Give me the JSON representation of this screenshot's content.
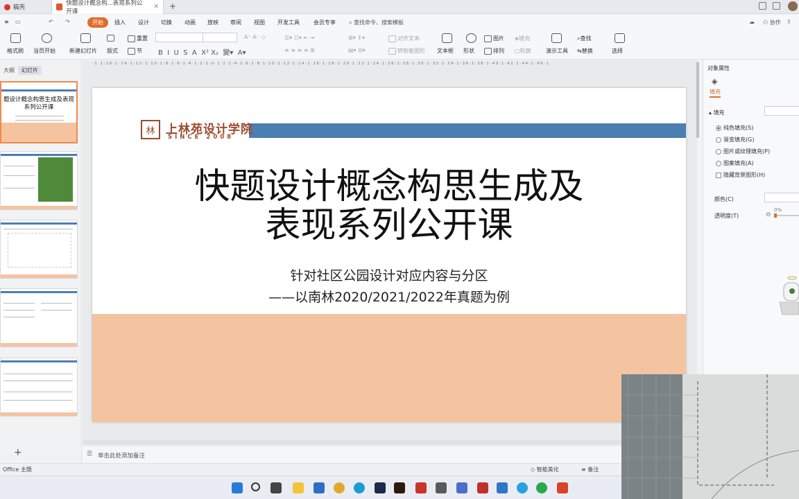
{
  "tabs": [
    {
      "label": "稿壳"
    },
    {
      "label": "快题设计概念构...表现系列公开课"
    }
  ],
  "menu": {
    "items": [
      "开始",
      "插入",
      "设计",
      "切换",
      "动画",
      "放映",
      "审阅",
      "视图",
      "开发工具",
      "会员专享"
    ],
    "active": "开始",
    "search": "查找命令、搜索模板",
    "collab": "协作",
    "share": "分享"
  },
  "ribbon": {
    "paste_label": "粘贴",
    "format_painter": "格式刷",
    "from_current": "当页开始",
    "new_slide": "新建幻灯片",
    "layout": "版式",
    "section": "节",
    "reset": "重置",
    "textbox": "文本框",
    "shape": "形状",
    "picture": "图片",
    "fill": "填充",
    "arrange": "排列",
    "outline": "轮廓",
    "presenter": "演示工具",
    "find": "查找",
    "replace": "替换",
    "select": "选择",
    "align_text": "对齐文本",
    "convert_smartart": "转智能图形"
  },
  "left_panel": {
    "tab_outline": "大纲",
    "tab_slides": "幻灯片",
    "thumb1_title": "题设计概念构思生成及表现系列公开课",
    "add": "+"
  },
  "slide": {
    "logo_glyph": "林",
    "logo_name": "上林苑设计学院",
    "logo_since": "SINCE 2008",
    "title_line1": "快题设计概念构思生成及",
    "title_line2": "表现系列公开课",
    "subtitle1": "针对社区公园设计对应内容与分区",
    "subtitle2": "——以南林2020/2021/2022年真题为例"
  },
  "notes": {
    "placeholder": "单击此处添加备注"
  },
  "status": {
    "theme": "Office 主题",
    "beautify": "智能美化",
    "notes": "备注"
  },
  "right_panel": {
    "title": "对象属性",
    "tab_fill": "填充",
    "section_fill": "填充",
    "options": [
      "纯色填充(S)",
      "渐变填充(G)",
      "图片或纹理填充(P)",
      "图案填充(A)"
    ],
    "selected_option": "纯色填充(S)",
    "hide_bg": "隐藏背景图形(H)",
    "color_label": "颜色(C)",
    "transparency_label": "透明度(T)",
    "transparency_value": "0%"
  },
  "colors": {
    "accent_orange": "#e06c2e",
    "slide_blue": "#4b7fb3",
    "slide_peach": "#f4c3a0",
    "logo_brown": "#9b4a2e"
  }
}
